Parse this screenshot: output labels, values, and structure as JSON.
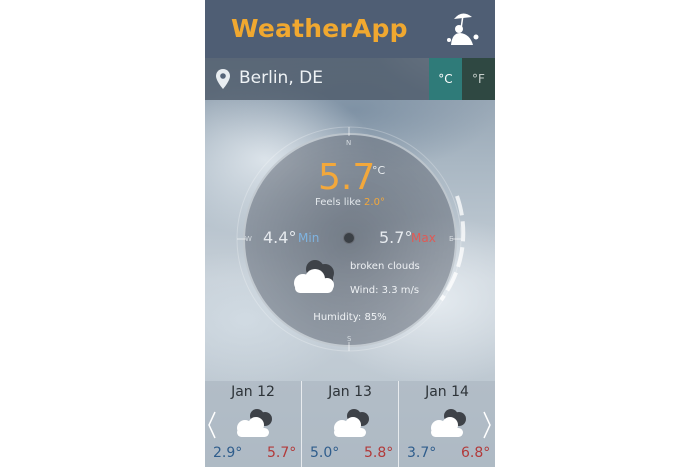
{
  "app": {
    "title": "WeatherApp"
  },
  "location": {
    "name": "Berlin, DE"
  },
  "units": {
    "celsius_label": "°C",
    "fahrenheit_label": "°F",
    "selected": "celsius"
  },
  "current": {
    "temp": "5.7",
    "unit": "°C",
    "feels_like_label": "Feels like",
    "feels_like_value": "2.0°",
    "min_temp": "4.4°",
    "min_label": "Min",
    "max_temp": "5.7°",
    "max_label": "Max",
    "description": "broken clouds",
    "wind": "Wind: 3.3 m/s",
    "humidity": "Humidity: 85%",
    "icon": "broken-clouds-icon"
  },
  "compass": {
    "n": "N",
    "s": "S",
    "e": "E",
    "w": "W"
  },
  "forecast": [
    {
      "date": "Jan 12",
      "min": "2.9°",
      "max": "5.7°",
      "icon": "broken-clouds-icon"
    },
    {
      "date": "Jan 13",
      "min": "5.0°",
      "max": "5.8°",
      "icon": "broken-clouds-icon"
    },
    {
      "date": "Jan 14",
      "min": "3.7°",
      "max": "6.8°",
      "icon": "broken-clouds-icon"
    }
  ],
  "colors": {
    "header": "#4f5e74",
    "accent": "#f0a830",
    "unit_selected": "#2f7b79",
    "unit_unselected": "#2f4842",
    "min": "#7fb3e0",
    "max": "#e05a55"
  }
}
